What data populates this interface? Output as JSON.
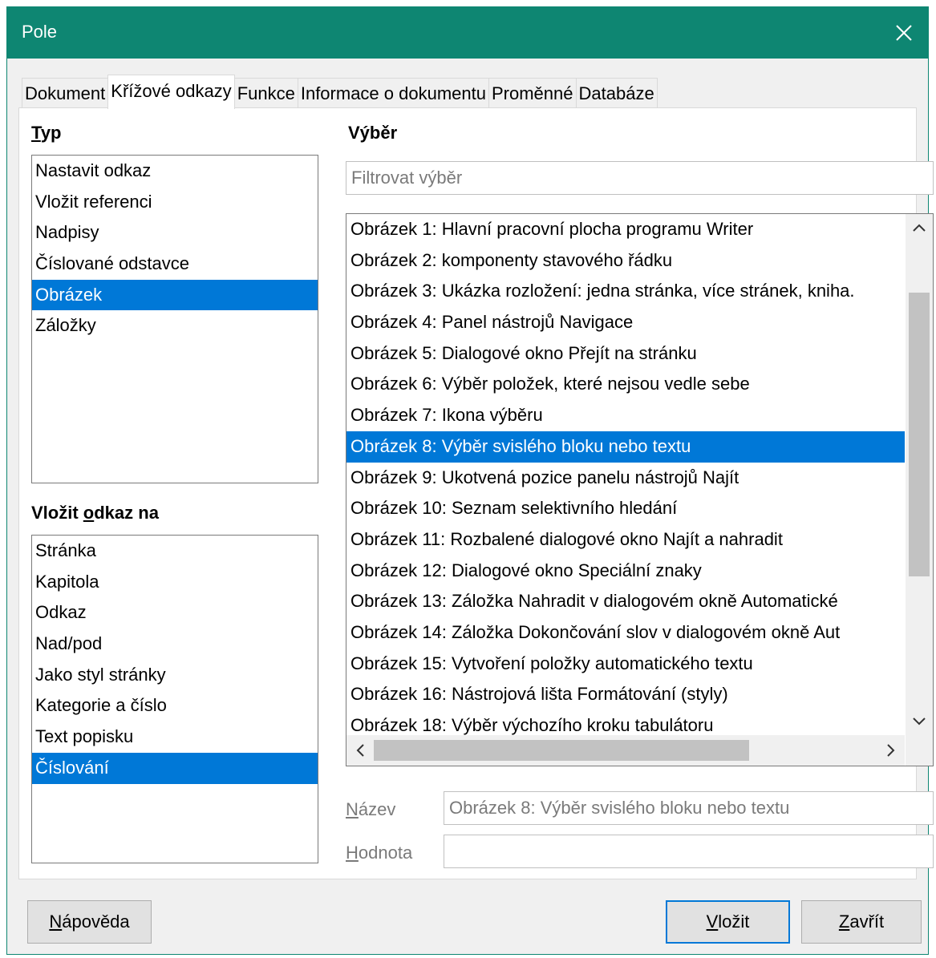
{
  "window": {
    "title": "Pole"
  },
  "tabs": [
    {
      "label": "Dokument",
      "active": false
    },
    {
      "label": "Křížové odkazy",
      "active": true
    },
    {
      "label": "Funkce",
      "active": false
    },
    {
      "label": "Informace o dokumentu",
      "active": false
    },
    {
      "label": "Proměnné",
      "active": false
    },
    {
      "label": "Databáze",
      "active": false
    }
  ],
  "type_section": {
    "label_first": "T",
    "label_rest": "yp",
    "items": [
      {
        "label": "Nastavit odkaz"
      },
      {
        "label": "Vložit referenci"
      },
      {
        "label": "Nadpisy"
      },
      {
        "label": "Číslované odstavce"
      },
      {
        "label": "Obrázek",
        "selected": true
      },
      {
        "label": "Záložky"
      }
    ]
  },
  "insert_section": {
    "label_a": "Vložit ",
    "label_b": "o",
    "label_c": "dkaz na",
    "items": [
      {
        "label": "Stránka"
      },
      {
        "label": "Kapitola"
      },
      {
        "label": "Odkaz"
      },
      {
        "label": "Nad/pod"
      },
      {
        "label": "Jako styl stránky"
      },
      {
        "label": "Kategorie a číslo"
      },
      {
        "label": "Text popisku"
      },
      {
        "label": "Číslování",
        "selected": true
      }
    ]
  },
  "selection_section": {
    "label": "Výběr",
    "filter_placeholder": "Filtrovat výběr",
    "items": [
      {
        "label": "Obrázek 1: Hlavní pracovní plocha programu Writer"
      },
      {
        "label": "Obrázek 2: komponenty stavového řádku"
      },
      {
        "label": "Obrázek 3: Ukázka rozložení: jedna stránka, více stránek, kniha."
      },
      {
        "label": "Obrázek 4: Panel nástrojů Navigace"
      },
      {
        "label": "Obrázek 5: Dialogové okno Přejít na stránku"
      },
      {
        "label": "Obrázek 6: Výběr položek, které nejsou vedle sebe"
      },
      {
        "label": "Obrázek 7: Ikona výběru"
      },
      {
        "label": "Obrázek 8: Výběr svislého bloku nebo textu",
        "selected": true
      },
      {
        "label": "Obrázek 9: Ukotvená pozice panelu nástrojů Najít"
      },
      {
        "label": "Obrázek 10: Seznam selektivního hledání"
      },
      {
        "label": "Obrázek 11: Rozbalené dialogové okno Najít a nahradit"
      },
      {
        "label": "Obrázek 12: Dialogové okno Speciální znaky"
      },
      {
        "label": "Obrázek 13: Záložka Nahradit v dialogovém okně Automatické"
      },
      {
        "label": "Obrázek 14: Záložka Dokončování slov v dialogovém okně Aut"
      },
      {
        "label": "Obrázek 15: Vytvoření položky automatického textu"
      },
      {
        "label": "Obrázek 16: Nástrojová lišta Formátování (styly)"
      },
      {
        "label": "Obrázek 18: Výběr výchozího kroku tabulátoru"
      }
    ]
  },
  "fields": {
    "name_label_first": "N",
    "name_label_rest": "ázev",
    "name_value": "Obrázek 8: Výběr svislého bloku nebo textu",
    "value_label_first": "H",
    "value_label_rest": "odnota",
    "value_value": ""
  },
  "buttons": {
    "help_first": "N",
    "help_rest": "ápověda",
    "insert_first": "V",
    "insert_rest": "ložit",
    "close_first": "Z",
    "close_rest": "avřít"
  },
  "colors": {
    "titlebar": "#0e8672",
    "selection": "#0078d7"
  }
}
